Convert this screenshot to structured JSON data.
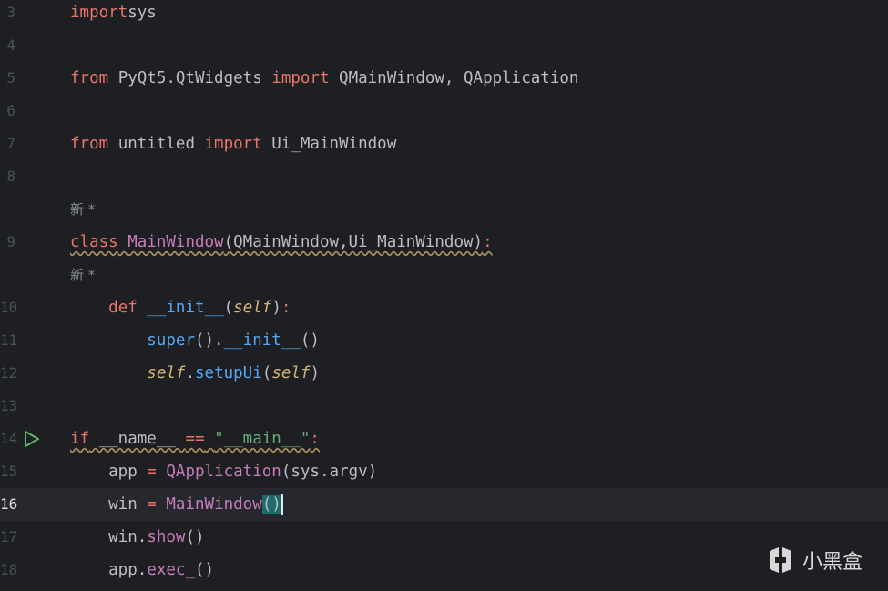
{
  "lines": [
    {
      "n": "3",
      "tokens": [
        [
          "kw2",
          "import"
        ],
        [
          "",
          "sys"
        ]
      ]
    },
    {
      "n": "4",
      "tokens": []
    },
    {
      "n": "5",
      "tokens": [
        [
          "kw2",
          "from"
        ],
        [
          "",
          " PyQt5.QtWidgets "
        ],
        [
          "kw2",
          "import"
        ],
        [
          "",
          " QMainWindow, QApplication"
        ]
      ]
    },
    {
      "n": "6",
      "tokens": []
    },
    {
      "n": "7",
      "tokens": [
        [
          "kw2",
          "from"
        ],
        [
          "",
          " untitled "
        ],
        [
          "kw2",
          "import"
        ],
        [
          "",
          " Ui_MainWindow"
        ]
      ]
    },
    {
      "n": "8",
      "tokens": []
    },
    {
      "hint": "新 *"
    },
    {
      "n": "9",
      "tokens": [
        [
          "kw2 wavy",
          "class"
        ],
        [
          "wavy",
          " "
        ],
        [
          "cls wavy",
          "MainWindow"
        ],
        [
          "wavy",
          "(QMainWindow,Ui_MainWindow)"
        ],
        [
          "kw2 wavy",
          ":"
        ]
      ]
    },
    {
      "hint": "    新 *"
    },
    {
      "n": "10",
      "tokens": [
        [
          "",
          "    "
        ],
        [
          "kw2",
          "def"
        ],
        [
          "",
          " "
        ],
        [
          "fn",
          "__init__"
        ],
        [
          "",
          "("
        ],
        [
          "selfw",
          "self"
        ],
        [
          "",
          ")"
        ],
        [
          "kw2",
          ":"
        ]
      ]
    },
    {
      "n": "11",
      "tokens": [
        [
          "",
          "        "
        ],
        [
          "fn",
          "super"
        ],
        [
          "",
          "()."
        ],
        [
          "fn",
          "__init__"
        ],
        [
          "",
          "()"
        ]
      ]
    },
    {
      "n": "12",
      "tokens": [
        [
          "",
          "        "
        ],
        [
          "selfw",
          "self"
        ],
        [
          "",
          "."
        ],
        [
          "fn",
          "setupUi"
        ],
        [
          "",
          "("
        ],
        [
          "selfw",
          "self"
        ],
        [
          "",
          ")"
        ]
      ]
    },
    {
      "n": "13",
      "tokens": []
    },
    {
      "n": "14",
      "run": true,
      "tokens": [
        [
          "kw2 wavy",
          "if"
        ],
        [
          "wavy",
          " __name__ "
        ],
        [
          "kw2 wavy",
          "=="
        ],
        [
          "wavy",
          " "
        ],
        [
          "str wavy",
          "\"__main__\""
        ],
        [
          "kw2 wavy",
          ":"
        ]
      ]
    },
    {
      "n": "15",
      "tokens": [
        [
          "",
          "    app "
        ],
        [
          "kw2",
          "="
        ],
        [
          "",
          " "
        ],
        [
          "purple",
          "QApplication"
        ],
        [
          "",
          "(sys.argv)"
        ]
      ]
    },
    {
      "n": "16",
      "current": true,
      "tokens": [
        [
          "",
          "    win "
        ],
        [
          "kw2",
          "="
        ],
        [
          "",
          " "
        ],
        [
          "purple",
          "MainWindow"
        ],
        [
          "bracket-hl",
          "()"
        ],
        [
          "caret",
          ""
        ]
      ]
    },
    {
      "n": "17",
      "tokens": [
        [
          "",
          "    win."
        ],
        [
          "purple",
          "show"
        ],
        [
          "",
          "()"
        ]
      ]
    },
    {
      "n": "18",
      "tokens": [
        [
          "",
          "    app."
        ],
        [
          "purple",
          "exec_"
        ],
        [
          "",
          "()"
        ]
      ]
    }
  ],
  "watermark": {
    "text": "小黑盒"
  }
}
